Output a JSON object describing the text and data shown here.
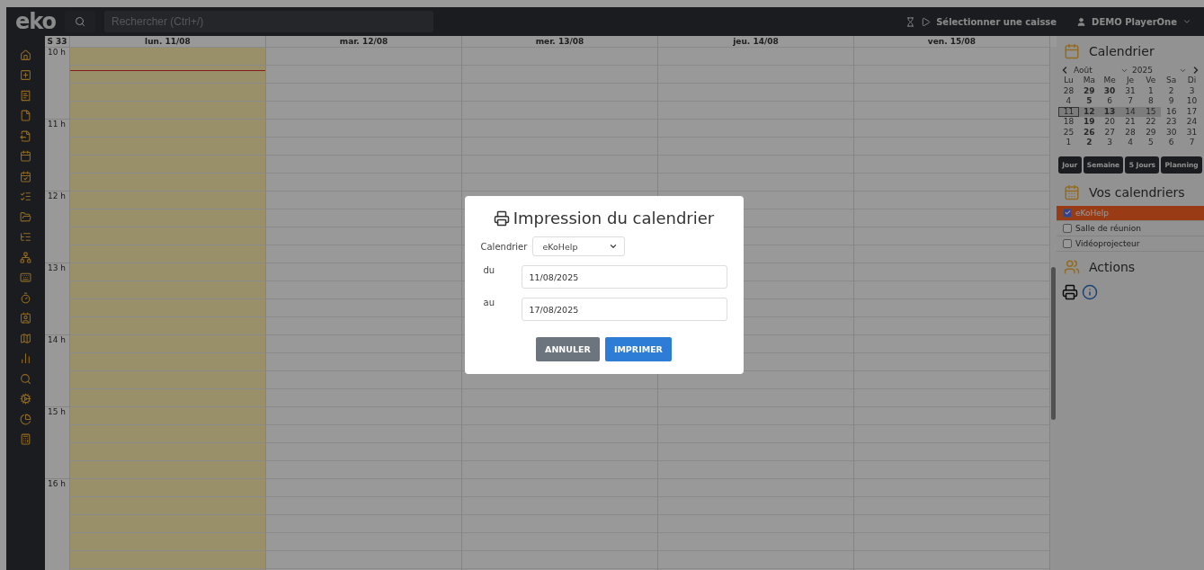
{
  "header": {
    "logo": "eko",
    "search": {
      "placeholder": "Rechercher (Ctrl+/)"
    },
    "register_button": "Sélectionner une caisse",
    "user_menu": "DEMO PlayerOne"
  },
  "week": {
    "label": "S 33",
    "days": [
      {
        "label": "lun. 11/08",
        "today": true
      },
      {
        "label": "mar. 12/08",
        "today": false
      },
      {
        "label": "mer. 13/08",
        "today": false
      },
      {
        "label": "jeu. 14/08",
        "today": false
      },
      {
        "label": "ven. 15/08",
        "today": false
      }
    ],
    "hours": [
      "10 h",
      "11 h",
      "12 h",
      "13 h",
      "14 h",
      "15 h",
      "16 h"
    ]
  },
  "sidebar": {
    "calendar_title": "Calendrier",
    "month": "Août",
    "year": "2025",
    "weekdays": [
      "Lu",
      "Ma",
      "Me",
      "Je",
      "Ve",
      "Sa",
      "Di"
    ],
    "weeks": [
      [
        {
          "d": "28",
          "bold": false,
          "in_week": false,
          "today": false
        },
        {
          "d": "29",
          "bold": true,
          "in_week": false,
          "today": false
        },
        {
          "d": "30",
          "bold": true,
          "in_week": false,
          "today": false
        },
        {
          "d": "31",
          "bold": false,
          "in_week": false,
          "today": false
        },
        {
          "d": "1",
          "bold": false,
          "in_week": false,
          "today": false
        },
        {
          "d": "2",
          "bold": false,
          "in_week": false,
          "today": false
        },
        {
          "d": "3",
          "bold": false,
          "in_week": false,
          "today": false
        }
      ],
      [
        {
          "d": "4",
          "bold": false,
          "in_week": false,
          "today": false
        },
        {
          "d": "5",
          "bold": true,
          "in_week": false,
          "today": false
        },
        {
          "d": "6",
          "bold": false,
          "in_week": false,
          "today": false
        },
        {
          "d": "7",
          "bold": false,
          "in_week": false,
          "today": false
        },
        {
          "d": "8",
          "bold": false,
          "in_week": false,
          "today": false
        },
        {
          "d": "9",
          "bold": false,
          "in_week": false,
          "today": false
        },
        {
          "d": "10",
          "bold": false,
          "in_week": false,
          "today": false
        }
      ],
      [
        {
          "d": "11",
          "bold": false,
          "in_week": true,
          "today": true
        },
        {
          "d": "12",
          "bold": true,
          "in_week": true,
          "today": false
        },
        {
          "d": "13",
          "bold": true,
          "in_week": true,
          "today": false
        },
        {
          "d": "14",
          "bold": false,
          "in_week": true,
          "today": false
        },
        {
          "d": "15",
          "bold": false,
          "in_week": true,
          "today": false
        },
        {
          "d": "16",
          "bold": false,
          "in_week": false,
          "today": false
        },
        {
          "d": "17",
          "bold": false,
          "in_week": false,
          "today": false
        }
      ],
      [
        {
          "d": "18",
          "bold": false,
          "in_week": false,
          "today": false
        },
        {
          "d": "19",
          "bold": true,
          "in_week": false,
          "today": false
        },
        {
          "d": "20",
          "bold": false,
          "in_week": false,
          "today": false
        },
        {
          "d": "21",
          "bold": false,
          "in_week": false,
          "today": false
        },
        {
          "d": "22",
          "bold": false,
          "in_week": false,
          "today": false
        },
        {
          "d": "23",
          "bold": false,
          "in_week": false,
          "today": false
        },
        {
          "d": "24",
          "bold": false,
          "in_week": false,
          "today": false
        }
      ],
      [
        {
          "d": "25",
          "bold": false,
          "in_week": false,
          "today": false
        },
        {
          "d": "26",
          "bold": true,
          "in_week": false,
          "today": false
        },
        {
          "d": "27",
          "bold": false,
          "in_week": false,
          "today": false
        },
        {
          "d": "28",
          "bold": false,
          "in_week": false,
          "today": false
        },
        {
          "d": "29",
          "bold": false,
          "in_week": false,
          "today": false
        },
        {
          "d": "30",
          "bold": false,
          "in_week": false,
          "today": false
        },
        {
          "d": "31",
          "bold": false,
          "in_week": false,
          "today": false
        }
      ],
      [
        {
          "d": "1",
          "bold": false,
          "in_week": false,
          "today": false
        },
        {
          "d": "2",
          "bold": true,
          "in_week": false,
          "today": false
        },
        {
          "d": "3",
          "bold": false,
          "in_week": false,
          "today": false
        },
        {
          "d": "4",
          "bold": false,
          "in_week": false,
          "today": false
        },
        {
          "d": "5",
          "bold": false,
          "in_week": false,
          "today": false
        },
        {
          "d": "6",
          "bold": false,
          "in_week": false,
          "today": false
        },
        {
          "d": "7",
          "bold": false,
          "in_week": false,
          "today": false
        }
      ]
    ],
    "views": [
      "Jour",
      "Semaine",
      "5 Jours",
      "Planning"
    ],
    "calendars_title": "Vos calendriers",
    "calendars": [
      {
        "label": "eKoHelp",
        "checked": true,
        "selected": true
      },
      {
        "label": "Salle de réunion",
        "checked": false,
        "selected": false
      },
      {
        "label": "Vidéoprojecteur",
        "checked": false,
        "selected": false
      }
    ],
    "actions_title": "Actions"
  },
  "modal": {
    "title": "Impression du calendrier",
    "calendar_label": "Calendrier",
    "calendar_value": "eKoHelp",
    "fields": [
      {
        "label": "du",
        "value": "11/08/2025"
      },
      {
        "label": "au",
        "value": "17/08/2025"
      }
    ],
    "buttons": [
      {
        "label": "ANNULER",
        "kind": "cancel"
      },
      {
        "label": "IMPRIMER",
        "kind": "primary"
      }
    ]
  }
}
